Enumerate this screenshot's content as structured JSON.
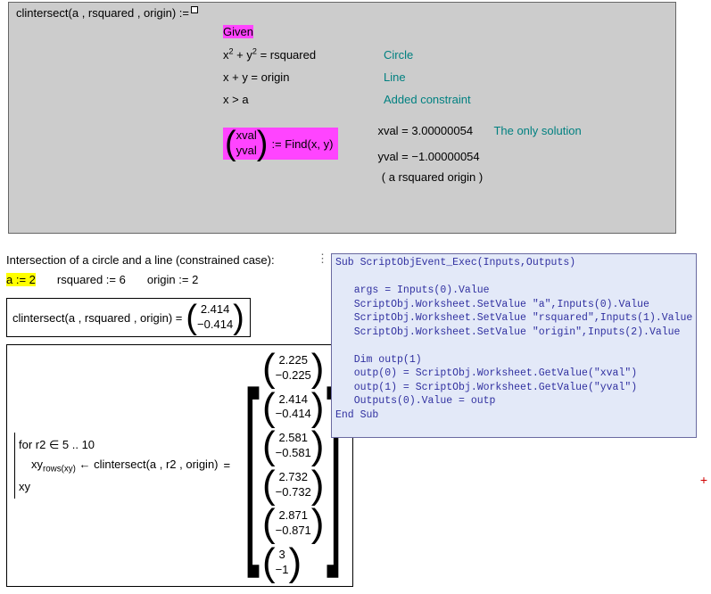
{
  "funcdef": {
    "signature": "clintersect(a , rsquared , origin) :=",
    "given": "Given",
    "eq1": {
      "math_html": "x<sup>2</sup> + y<sup>2</sup> = rsquared",
      "comment": "Circle"
    },
    "eq2": {
      "math": "x + y = origin",
      "comment": "Line"
    },
    "eq3": {
      "math": "x > a",
      "comment": "Added constraint"
    },
    "find": {
      "r1": "xval",
      "r2": "yval",
      "assign": ":= Find(x, y)",
      "out1": "xval = 3.00000054",
      "out2": "yval = −1.00000054",
      "comment": "The only solution"
    },
    "return": "( a  rsquared  origin )"
  },
  "section_label": "Intersection of a circle and a line (constrained case):",
  "assigns": {
    "a": "a := 2",
    "r": "rsquared := 6",
    "o": "origin := 2"
  },
  "result": {
    "lhs": "clintersect(a , rsquared , origin) =",
    "r1": "2.414",
    "r2": "−0.414"
  },
  "program": {
    "l1": "for  r2 ∈ 5 .. 10",
    "l2_pre": "xy",
    "l2_sub": "rows(xy)",
    "l2_post": " ← clintersect(a , r2 , origin)",
    "l3": "xy",
    "matrix": [
      [
        "2.225",
        "−0.225"
      ],
      [
        "2.414",
        "−0.414"
      ],
      [
        "2.581",
        "−0.581"
      ],
      [
        "2.732",
        "−0.732"
      ],
      [
        "2.871",
        "−0.871"
      ],
      [
        "3",
        "−1"
      ]
    ]
  },
  "script": {
    "code": "Sub ScriptObjEvent_Exec(Inputs,Outputs)\n\n   args = Inputs(0).Value\n   ScriptObj.Worksheet.SetValue \"a\",Inputs(0).Value\n   ScriptObj.Worksheet.SetValue \"rsquared\",Inputs(1).Value\n   ScriptObj.Worksheet.SetValue \"origin\",Inputs(2).Value\n\n   Dim outp(1)\n   outp(0) = ScriptObj.Worksheet.GetValue(\"xval\")\n   outp(1) = ScriptObj.Worksheet.GetValue(\"yval\")\n   Outputs(0).Value = outp\nEnd Sub"
  },
  "crosshair": "+"
}
